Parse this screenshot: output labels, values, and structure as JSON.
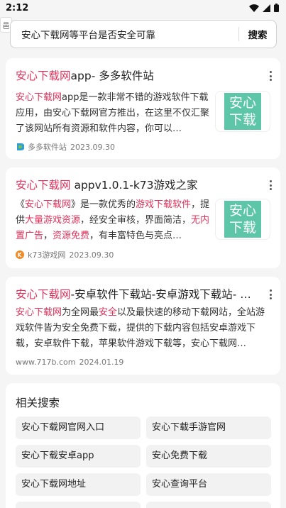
{
  "status": {
    "time": "2:12"
  },
  "search": {
    "side_tab": "⾢",
    "query": "安心下载网等平台是否安全可靠",
    "button": "搜索"
  },
  "results": [
    {
      "title_highlight": "安心下载网",
      "title_rest": "app- 多多软件站",
      "snippet_parts": [
        {
          "t": "安心下载网",
          "hl": true
        },
        {
          "t": "app是一款非常不错的游戏软件下载应用，由安心下载网官方推出，在这里不仅汇聚了该网站所有资源和软件内容，你可以…",
          "hl": false
        }
      ],
      "thumb_text": "安心下载",
      "source": "多多软件站",
      "date": "2023.09.30"
    },
    {
      "title_highlight": "安心下载网",
      "title_rest": " appv1.0.1-k73游戏之家",
      "snippet_parts": [
        {
          "t": "《",
          "hl": false
        },
        {
          "t": "安心下载网",
          "hl": true
        },
        {
          "t": "》是一款优秀的",
          "hl": false
        },
        {
          "t": "游戏下载软件",
          "hl": true
        },
        {
          "t": "，提供",
          "hl": false
        },
        {
          "t": "大量游戏资源",
          "hl": true
        },
        {
          "t": "，经安全审核，界面简洁，",
          "hl": false
        },
        {
          "t": "无内置广告",
          "hl": true
        },
        {
          "t": "，",
          "hl": false
        },
        {
          "t": "资源免费",
          "hl": true
        },
        {
          "t": "，有丰富特色与亮点…",
          "hl": false
        }
      ],
      "thumb_text": "安心下载",
      "source": "k73游戏网",
      "date": "2023.09.30"
    },
    {
      "title_highlight": "安心下载网",
      "title_rest": "-安卓软件下载站-安卓游戏下载站- 游…",
      "snippet_parts": [
        {
          "t": "安心下载网",
          "hl": true
        },
        {
          "t": "为全网最",
          "hl": false
        },
        {
          "t": "安全",
          "hl": true
        },
        {
          "t": "以及最快速的移动下载网站，全站游戏软件皆为安全免费下载，提供的下载内容包括安卓游戏下载，安卓软件下载，苹果软件游戏下载等，安心下载网…",
          "hl": false
        }
      ],
      "source": "www.717b.com",
      "date": "2024.01.19"
    }
  ],
  "related": {
    "title": "相关搜索",
    "items": [
      "安心下载网官网入口",
      "安心下载手游官网",
      "安心下载安卓app",
      "安心免费下载",
      "安心下载网地址",
      "安心查询平台"
    ]
  },
  "colors": {
    "highlight": "#e0325a",
    "thumb_bg": "#5ec6a8"
  }
}
